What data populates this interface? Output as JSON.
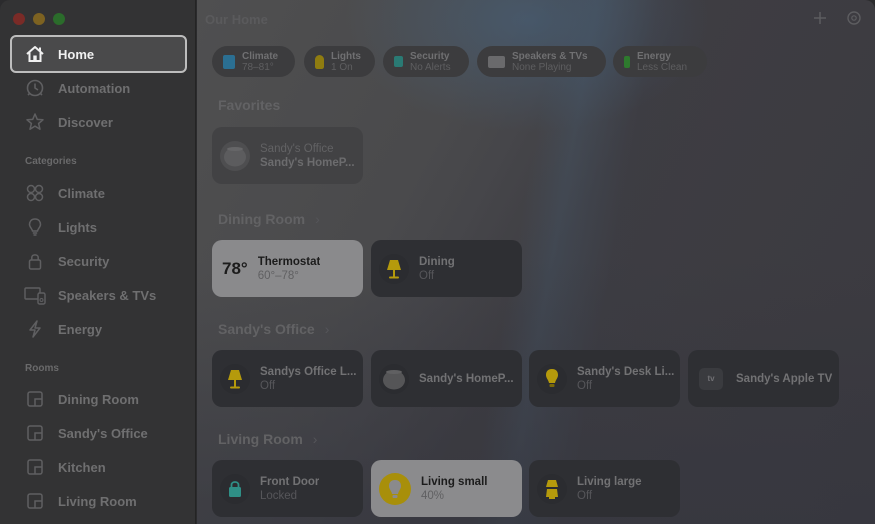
{
  "window": {
    "traffic_lights": [
      "close",
      "minimize",
      "maximize"
    ]
  },
  "sidebar": {
    "primary": [
      {
        "label": "Home",
        "icon": "house-icon",
        "active": true
      },
      {
        "label": "Automation",
        "icon": "clock-icon",
        "active": false
      },
      {
        "label": "Discover",
        "icon": "star-icon",
        "active": false
      }
    ],
    "categories_label": "Categories",
    "categories": [
      {
        "label": "Climate",
        "icon": "fan-icon"
      },
      {
        "label": "Lights",
        "icon": "lightbulb-icon"
      },
      {
        "label": "Security",
        "icon": "lock-icon"
      },
      {
        "label": "Speakers & TVs",
        "icon": "tv-speaker-icon"
      },
      {
        "label": "Energy",
        "icon": "bolt-icon"
      }
    ],
    "rooms_label": "Rooms",
    "rooms": [
      {
        "label": "Dining Room",
        "icon": "room-icon"
      },
      {
        "label": "Sandy's Office",
        "icon": "room-icon"
      },
      {
        "label": "Kitchen",
        "icon": "room-icon"
      },
      {
        "label": "Living Room",
        "icon": "room-icon"
      }
    ]
  },
  "header": {
    "title": "Our Home",
    "add_icon": "plus-icon",
    "activity_icon": "activity-icon"
  },
  "status_pills": [
    {
      "title": "Climate",
      "subtitle": "78–81°",
      "icon": "climate-icon",
      "color": "#2b6f92"
    },
    {
      "title": "Lights",
      "subtitle": "1 On",
      "icon": "lightbulb-icon",
      "color": "#8f7c10"
    },
    {
      "title": "Security",
      "subtitle": "No Alerts",
      "icon": "lock-icon",
      "color": "#2a7a74"
    },
    {
      "title": "Speakers & TVs",
      "subtitle": "None Playing",
      "icon": "tv-speaker-icon",
      "color": "#6a6a6c"
    },
    {
      "title": "Energy",
      "subtitle": "Less Clean",
      "icon": "leaf-bolt-icon",
      "color": "#2e7a2e"
    }
  ],
  "sections": {
    "favorites": {
      "title": "Favorites",
      "tiles": [
        {
          "title": "Sandy's Office",
          "subtitle": "Sandy's HomeP...",
          "icon": "homepod-icon"
        }
      ]
    },
    "dining_room": {
      "title": "Dining Room",
      "tiles": [
        {
          "title": "Thermostat",
          "subtitle": "60°–78°",
          "value": "78°",
          "icon": "thermostat",
          "state": "on"
        },
        {
          "title": "Dining",
          "subtitle": "Off",
          "icon": "lamp-icon",
          "state": "off"
        }
      ]
    },
    "sandys_office": {
      "title": "Sandy's Office",
      "tiles": [
        {
          "title": "Sandys Office L...",
          "subtitle": "Off",
          "icon": "lamp-icon"
        },
        {
          "title": "Sandy's HomeP...",
          "subtitle": "",
          "icon": "homepod-icon"
        },
        {
          "title": "Sandy's Desk Li...",
          "subtitle": "Off",
          "icon": "lightbulb-icon"
        },
        {
          "title": "Sandy's Apple TV",
          "subtitle": "",
          "icon": "appletv-icon",
          "icon_text": "tv"
        }
      ]
    },
    "living_room": {
      "title": "Living Room",
      "tiles": [
        {
          "title": "Front Door",
          "subtitle": "Locked",
          "icon": "lock-icon"
        },
        {
          "title": "Living small",
          "subtitle": "40%",
          "icon": "lightbulb-icon",
          "state": "on"
        },
        {
          "title": "Living large",
          "subtitle": "Off",
          "icon": "lamp-icon"
        }
      ]
    }
  },
  "colors": {
    "accent_yellow": "#b59a0c",
    "lock_teal": "#2f8f86",
    "tile_on": "#8b8b8d"
  }
}
